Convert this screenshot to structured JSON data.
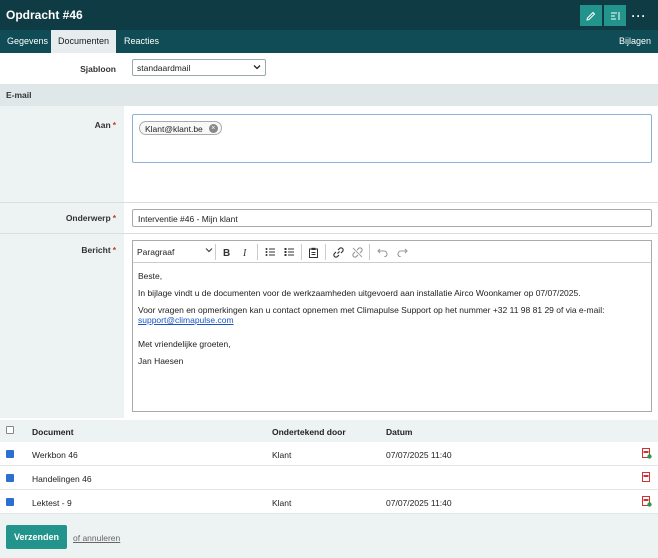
{
  "header": {
    "title": "Opdracht #46",
    "more_label": "···"
  },
  "tabs": [
    {
      "label": "Gegevens"
    },
    {
      "label": "Documenten"
    },
    {
      "label": "Reacties"
    }
  ],
  "tabs_right": {
    "label": "Bijlagen"
  },
  "form": {
    "template_label": "Sjabloon",
    "template_value": "standaardmail",
    "email_section": "E-mail",
    "to_label": "Aan",
    "to_tag": "Klant@klant.be",
    "subject_label": "Onderwerp",
    "subject_value": "Interventie #46 - Mijn klant",
    "message_label": "Bericht",
    "required_mark": "*"
  },
  "editor": {
    "paragraph_select": "Paragraaf",
    "body": {
      "greeting": "Beste,",
      "line1": "In bijlage vindt u de documenten voor de werkzaamheden uitgevoerd aan installatie Airco Woonkamer op 07/07/2025.",
      "line2": "Voor vragen en opmerkingen kan u contact opnemen met Climapulse Support op het nummer +32 11 98 81 29 of via e-mail:",
      "email": "support@climapulse.com",
      "closing": "Met vriendelijke groeten,",
      "signature": "Jan Haesen"
    }
  },
  "table": {
    "headers": {
      "document": "Document",
      "signed_by": "Ondertekend door",
      "date": "Datum"
    },
    "rows": [
      {
        "document": "Werkbon 46",
        "signed_by": "Klant",
        "date": "07/07/2025 11:40",
        "checked": true
      },
      {
        "document": "Handelingen 46",
        "signed_by": "",
        "date": "",
        "checked": true
      },
      {
        "document": "Lektest - 9",
        "signed_by": "Klant",
        "date": "07/07/2025 11:40",
        "checked": true
      }
    ]
  },
  "footer": {
    "send_label": "Verzenden",
    "cancel_label": "of annuleren"
  },
  "colors": {
    "header_bg": "#0f3b44",
    "accent": "#22948c",
    "link": "#1a55c4"
  }
}
